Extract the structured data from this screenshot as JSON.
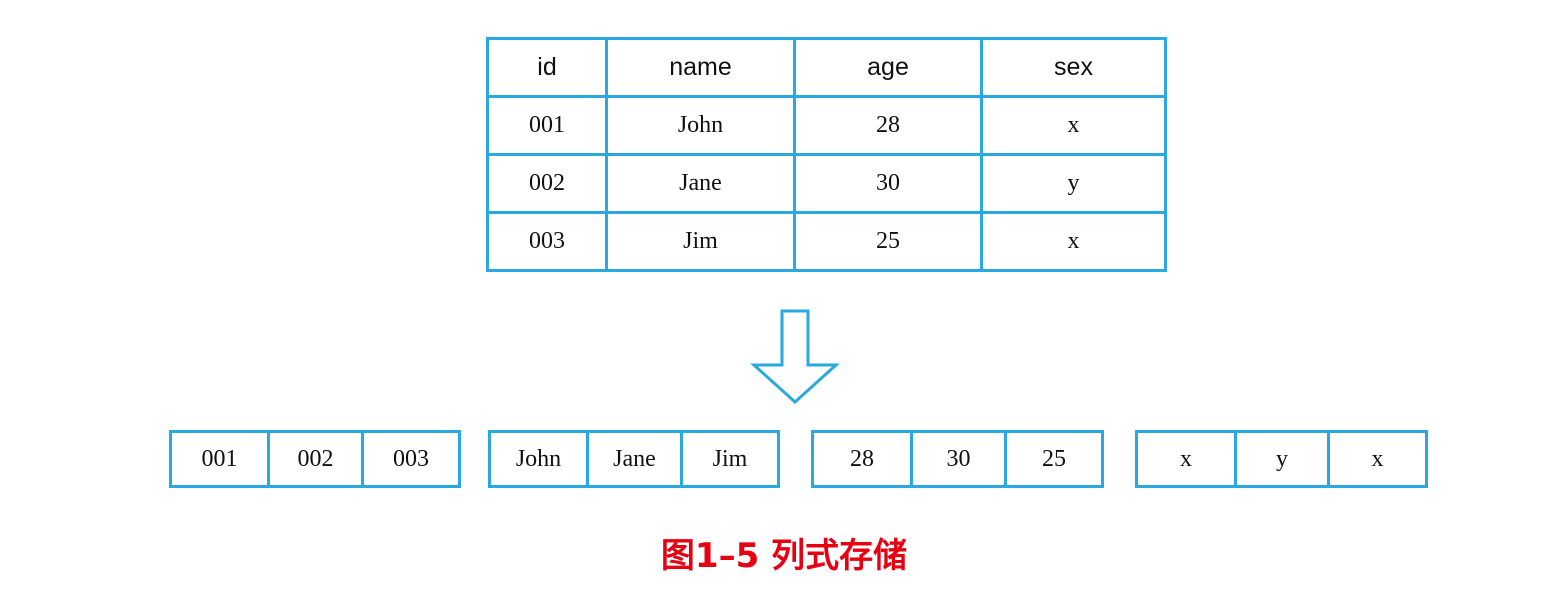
{
  "table": {
    "headers": [
      "id",
      "name",
      "age",
      "sex"
    ],
    "rows": [
      [
        "001",
        "John",
        "28",
        "x"
      ],
      [
        "002",
        "Jane",
        "30",
        "y"
      ],
      [
        "003",
        "Jim",
        "25",
        "x"
      ]
    ]
  },
  "columns": [
    [
      "001",
      "002",
      "003"
    ],
    [
      "John",
      "Jane",
      "Jim"
    ],
    [
      "28",
      "30",
      "25"
    ],
    [
      "x",
      "y",
      "x"
    ]
  ],
  "caption": "图1–5 列式存储",
  "colors": {
    "border": "#29a9df",
    "caption": "#e60012"
  },
  "icons": {
    "arrow": "down-arrow-icon"
  }
}
